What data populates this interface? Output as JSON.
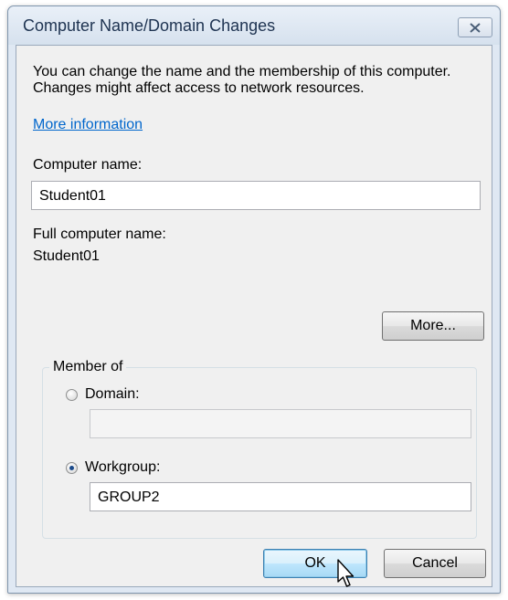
{
  "window": {
    "title": "Computer Name/Domain Changes",
    "close_icon": "close-icon"
  },
  "description": "You can change the name and the membership of this computer. Changes might affect access to network resources.",
  "more_info_link": "More information",
  "computer_name": {
    "label": "Computer name:",
    "value": "Student01"
  },
  "full_computer_name": {
    "label": "Full computer name:",
    "value": "Student01"
  },
  "more_button": "More...",
  "member_of": {
    "legend": "Member of",
    "domain": {
      "label": "Domain:",
      "value": "",
      "selected": false
    },
    "workgroup": {
      "label": "Workgroup:",
      "value": "GROUP2",
      "selected": true
    }
  },
  "buttons": {
    "ok": "OK",
    "cancel": "Cancel"
  },
  "colors": {
    "link": "#0066cc",
    "title_text": "#1e3351",
    "default_button": "#bee6fd"
  },
  "cursor_icon": "mouse-pointer-icon"
}
